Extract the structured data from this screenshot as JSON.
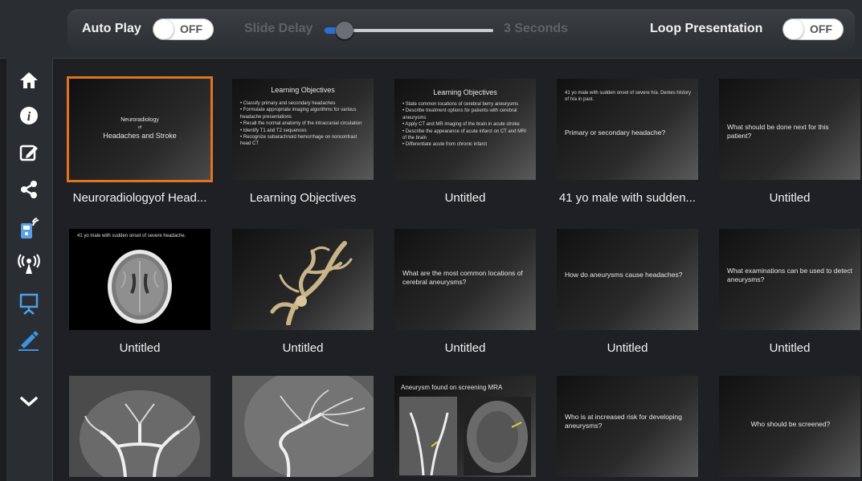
{
  "toolbar": {
    "autoplay_label": "Auto Play",
    "autoplay_state": "OFF",
    "slide_delay_label": "Slide Delay",
    "slide_delay_value": "3 Seconds",
    "loop_label": "Loop Presentation",
    "loop_state": "OFF"
  },
  "sidebar": {
    "items": [
      {
        "icon": "home-icon"
      },
      {
        "icon": "info-icon"
      },
      {
        "icon": "edit-icon"
      },
      {
        "icon": "share-icon"
      },
      {
        "icon": "remote-icon"
      },
      {
        "icon": "broadcast-icon"
      },
      {
        "icon": "presentation-icon"
      },
      {
        "icon": "pen-icon"
      },
      {
        "icon": "chevron-down-icon"
      }
    ]
  },
  "slides": [
    {
      "caption": "Neuroradiologyof Head...",
      "lines": [
        "Neuroradiology",
        "of",
        "Headaches and Stroke"
      ]
    },
    {
      "caption": "Learning Objectives",
      "title": "Learning Objectives",
      "bullets": [
        "Classify primary and secondary headaches",
        "Formulate appropriate imaging algorithms for various headache presentations",
        "Recall the normal anatomy of the intracranial circulation",
        "Identify T1 and T2 sequences",
        "Recognize subarachnoid hemorrhage on noncontrast head CT"
      ]
    },
    {
      "caption": "Untitled",
      "title": "Learning Objectives",
      "bullets": [
        "State common locations of cerebral berry aneurysms",
        "Describe treatment options for patients with cerebral aneurysms",
        "Apply CT and MR imaging of the brain in acute stroke",
        "Describe the appearance of acute infarct on CT and MRI of the brain",
        "Differentiate acute from chronic infarct"
      ]
    },
    {
      "caption": "41 yo male with sudden...",
      "text": "41 yo male with sudden onset of severe h/a. Denies history of h/a in past.",
      "question": "Primary or secondary headache?"
    },
    {
      "caption": "Untitled",
      "question": "What should be done next for this patient?"
    },
    {
      "caption": "Untitled",
      "text": "41 yo male with sudden onset of severe headache."
    },
    {
      "caption": "Untitled"
    },
    {
      "caption": "Untitled",
      "question": "What are the most common locations of cerebral aneurysms?"
    },
    {
      "caption": "Untitled",
      "question": "How do aneurysms cause headaches?"
    },
    {
      "caption": "Untitled",
      "question": "What examinations can be used to detect aneurysms?"
    },
    {
      "caption": ""
    },
    {
      "caption": ""
    },
    {
      "caption": "",
      "title": "Aneurysm found on screening MRA"
    },
    {
      "caption": "",
      "question": "Who is at increased risk for developing aneurysms?"
    },
    {
      "caption": "",
      "question": "Who should be screened?"
    }
  ]
}
